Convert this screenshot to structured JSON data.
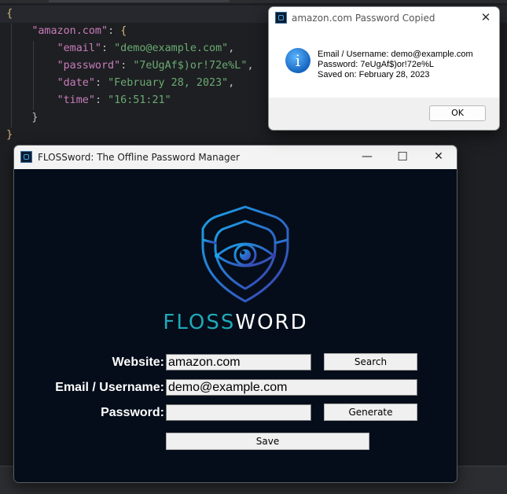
{
  "editor": {
    "lines": [
      {
        "indent": 0,
        "parts": [
          {
            "t": "{",
            "c": "brace"
          }
        ]
      },
      {
        "indent": 1,
        "parts": [
          {
            "t": "\"amazon.com\"",
            "c": "key"
          },
          {
            "t": ": ",
            "c": "punc"
          },
          {
            "t": "{",
            "c": "brace"
          }
        ]
      },
      {
        "indent": 2,
        "parts": [
          {
            "t": "\"email\"",
            "c": "key"
          },
          {
            "t": ": ",
            "c": "punc"
          },
          {
            "t": "\"demo@example.com\"",
            "c": "str"
          },
          {
            "t": ",",
            "c": "punc"
          }
        ]
      },
      {
        "indent": 2,
        "parts": [
          {
            "t": "\"password\"",
            "c": "key"
          },
          {
            "t": ": ",
            "c": "punc"
          },
          {
            "t": "\"7eUgAf$)or!72e%L\"",
            "c": "str"
          },
          {
            "t": ",",
            "c": "punc"
          }
        ]
      },
      {
        "indent": 2,
        "parts": [
          {
            "t": "\"date\"",
            "c": "key"
          },
          {
            "t": ": ",
            "c": "punc"
          },
          {
            "t": "\"February 28, 2023\"",
            "c": "str"
          },
          {
            "t": ",",
            "c": "punc"
          }
        ]
      },
      {
        "indent": 2,
        "parts": [
          {
            "t": "\"time\"",
            "c": "key"
          },
          {
            "t": ": ",
            "c": "punc"
          },
          {
            "t": "\"16:51:21\"",
            "c": "str"
          }
        ]
      },
      {
        "indent": 1,
        "parts": [
          {
            "t": "}",
            "c": "punc"
          }
        ]
      },
      {
        "indent": 0,
        "parts": [
          {
            "t": "}",
            "c": "brace"
          }
        ]
      }
    ]
  },
  "app": {
    "title": "FLOSSword: The Offline Password Manager",
    "controls": {
      "minimize": "—",
      "maximize": "☐",
      "close": "✕"
    },
    "brand": {
      "part1": "FLOSS",
      "part2": "WORD"
    },
    "form": {
      "website_label": "Website:",
      "website_value": "amazon.com",
      "email_label": "Email / Username:",
      "email_value": "demo@example.com",
      "password_label": "Password:",
      "password_value": "",
      "search_button": "Search",
      "generate_button": "Generate",
      "save_button": "Save"
    },
    "colors": {
      "background": "#050d1a",
      "brand_accent": "#1fa8b8",
      "logo_start": "#1aa3e8",
      "logo_end": "#3a3fb0"
    }
  },
  "dialog": {
    "title": "amazon.com Password Copied",
    "close": "✕",
    "icon": "information-icon",
    "icon_glyph": "i",
    "lines": [
      "Email / Username: demo@example.com",
      "Password: 7eUgAf$)or!72e%L",
      "Saved on: February 28, 2023"
    ],
    "ok_button": "OK"
  }
}
